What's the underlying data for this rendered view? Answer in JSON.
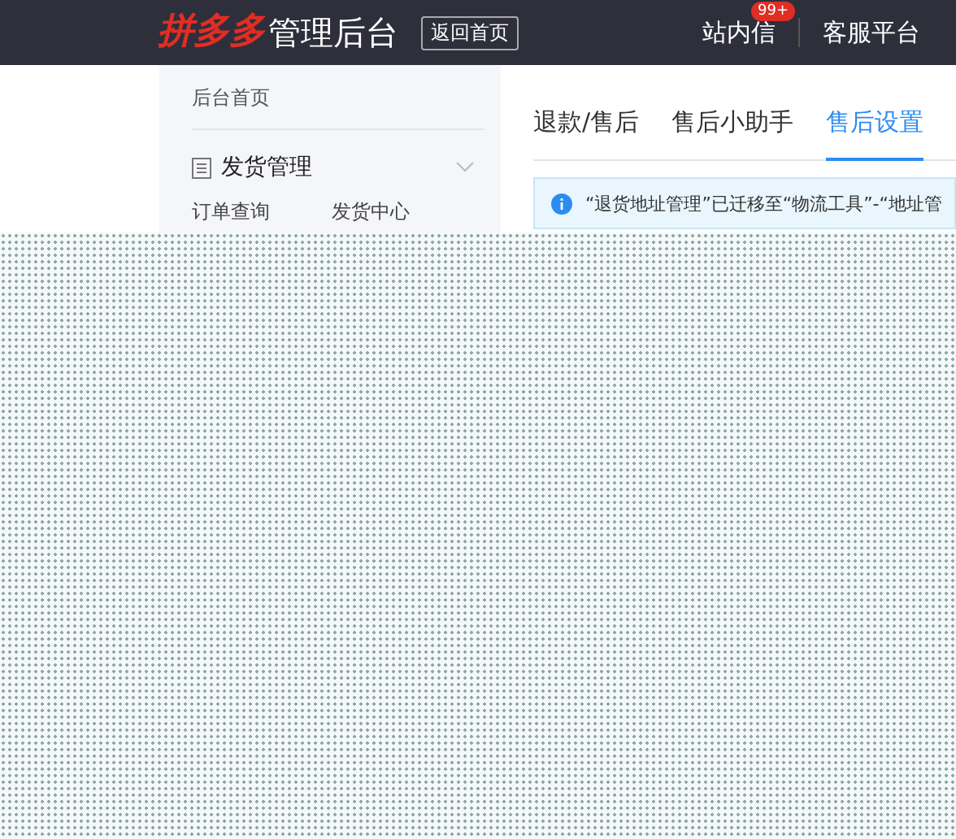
{
  "header": {
    "logo_brand": "拼多多",
    "logo_title": "管理后台",
    "home_button": "返回首页",
    "messages": {
      "label": "站内信",
      "badge": "99+"
    },
    "service": "客服平台"
  },
  "sidebar": {
    "home": "后台首页",
    "groups": [
      {
        "label": "发货管理",
        "expanded": true,
        "children": [
          {
            "label": "订单查询"
          },
          {
            "label": "发货中心"
          }
        ]
      }
    ]
  },
  "tabs": [
    {
      "label": "退款/售后",
      "selected": false
    },
    {
      "label": "售后小助手",
      "selected": false
    },
    {
      "label": "售后设置",
      "selected": true
    }
  ],
  "notice": "“退货地址管理”已迁移至“物流工具”-“地址管"
}
